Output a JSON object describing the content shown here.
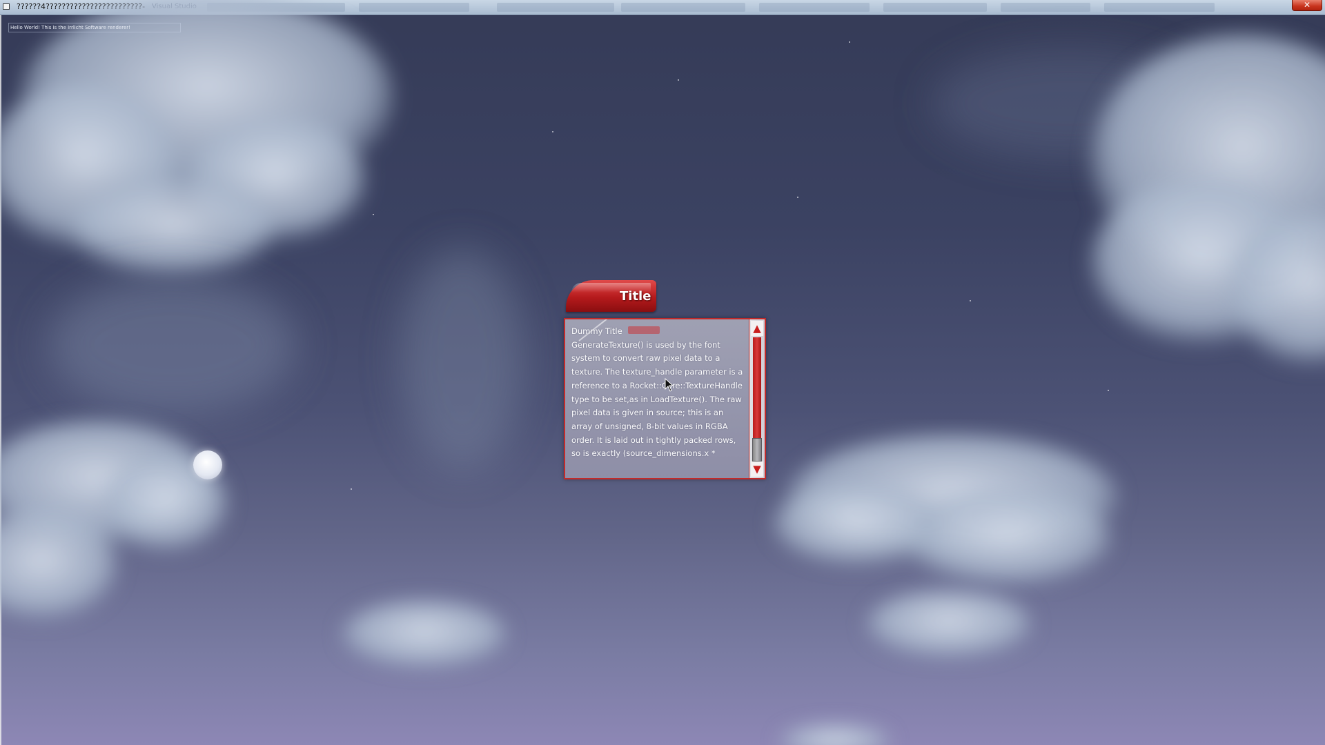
{
  "window": {
    "title": "??????4????????????????????????-",
    "background_app": "Visual Studio",
    "close_glyph": "✕"
  },
  "debug_text": "Hello World! This is the Irrlicht Software renderer!",
  "dialog": {
    "tab_title": "Title",
    "content_title": "Dummy Title",
    "content_body": "GenerateTexture() is used by the font system to convert raw pixel data to a texture. The texture_handle parameter is a reference to a Rocket::Core::TextureHandle type to be set,as in LoadTexture(). The raw pixel data is given in source; this is an array of unsigned, 8-bit values in RGBA order. It is laid out in tightly packed rows, so is exactly (source_dimensions.x *"
  },
  "scrollbar": {
    "up_glyph": "▲",
    "down_glyph": "▼"
  },
  "icons": {
    "app": "app-icon",
    "close": "close-icon",
    "cursor": "cursor-icon",
    "scroll_up": "arrow-up-icon",
    "scroll_down": "arrow-down-icon"
  },
  "colors": {
    "accent_red": "#c22a2a",
    "sky_top": "#353b57",
    "sky_bottom": "#8d87b5"
  }
}
